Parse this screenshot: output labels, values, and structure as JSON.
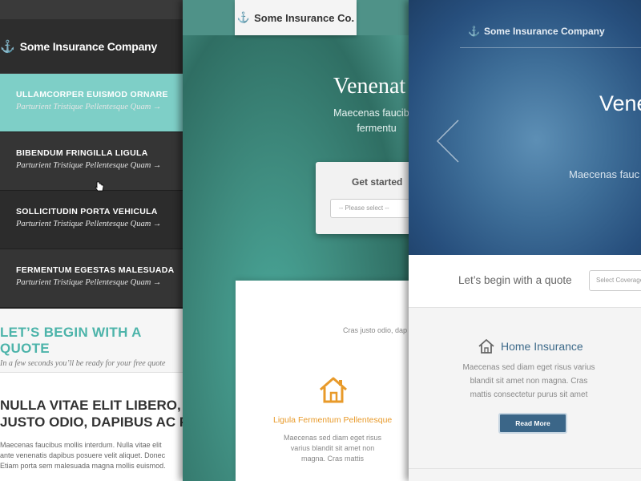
{
  "panel1": {
    "brand": "Some Insurance Company",
    "menu": [
      {
        "title": "ULLAMCORPER EUISMOD ORNARE",
        "sub": "Parturient Tristique Pellentesque Quam →"
      },
      {
        "title": "BIBENDUM FRINGILLA LIGULA",
        "sub": "Parturient Tristique Pellentesque Quam →"
      },
      {
        "title": "SOLLICITUDIN PORTA VEHICULA",
        "sub": "Parturient Tristique Pellentesque Quam →"
      },
      {
        "title": "FERMENTUM EGESTAS MALESUADA",
        "sub": "Parturient Tristique Pellentesque Quam →"
      }
    ],
    "quote_title": "LET’S BEGIN WITH A QUOTE",
    "quote_sub": "In a few seconds you’ll be ready for your free quote",
    "heading_line1": "NULLA VITAE ELIT LIBERO, A P",
    "heading_line2": "JUSTO ODIO, DAPIBUS AC FAC",
    "para_line1": "Maecenas faucibus mollis interdum. Nulla vitae elit",
    "para_line2": "ante venenatis dapibus posuere velit aliquet. Donec",
    "para_line3": "Etiam porta sem malesuada magna mollis euismod."
  },
  "panel2": {
    "brand": "Some Insurance Co.",
    "hero_title": "Venenat",
    "hero_sub_line1": "Maecenas faucibus",
    "hero_sub_line2": "fermentu",
    "cta_title": "Get started",
    "select_placeholder": "-- Please select --",
    "tagline": "Cras justo odio, dap",
    "feature_title": "Ligula Fermentum Pellentesque",
    "feature_text": "Maecenas sed diam eget risus varius blandit sit amet non magna. Cras mattis"
  },
  "panel3": {
    "brand": "Some Insurance Company",
    "hero_title": "Vene",
    "hero_sub": "Maecenas fauc",
    "quote_text": "Let’s begin with a quote",
    "coverage_placeholder": "Select Coverage",
    "card_title": "Home Insurance",
    "card_text": "Maecenas sed diam eget risus varius blandit sit amet non magna. Cras mattis consectetur purus sit amet",
    "read_more": "Read More"
  },
  "icons": {
    "brand": "anchor-icon",
    "house": "house-icon",
    "prev": "chevron-left-icon",
    "cursor": "hand-cursor-icon"
  },
  "colors": {
    "teal_accent": "#7ecfc7",
    "orange_accent": "#e89a2a",
    "blue_accent": "#3b6688"
  }
}
